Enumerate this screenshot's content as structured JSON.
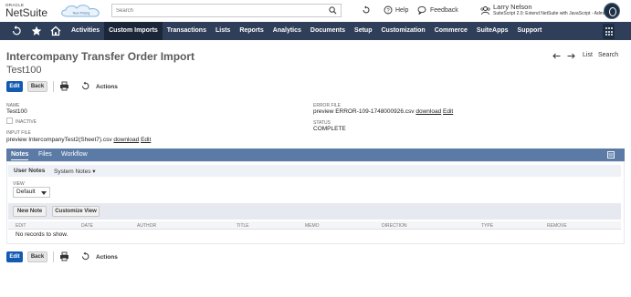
{
  "header": {
    "brand_top": "ORACLE",
    "brand": "NetSuite",
    "cloud_text": "New Pricing",
    "search_placeholder": "Search",
    "help": "Help",
    "feedback": "Feedback",
    "user_name": "Larry Nelson",
    "user_role": "SuiteScript 2.0: Extend NetSuite with JavaScript - Administrator"
  },
  "nav": {
    "items": [
      "Activities",
      "Custom Imports",
      "Transactions",
      "Lists",
      "Reports",
      "Analytics",
      "Documents",
      "Setup",
      "Customization",
      "Commerce",
      "SuiteApps",
      "Support"
    ],
    "active": "Custom Imports"
  },
  "page": {
    "title": "Intercompany Transfer Order Import",
    "record_name": "Test100",
    "record_nav": {
      "list": "List",
      "search": "Search"
    }
  },
  "buttons": {
    "edit": "Edit",
    "back": "Back",
    "actions": "Actions"
  },
  "fields": {
    "name_label": "NAME",
    "name_value": "Test100",
    "inactive_label": "INACTIVE",
    "input_file_label": "INPUT FILE",
    "input_file_value": "preview IntercompanyTest2(Sheet7).csv",
    "error_file_label": "ERROR FILE",
    "error_file_value": "preview ERROR-109-1748000926.csv",
    "status_label": "STATUS",
    "status_value": "COMPLETE",
    "download": "download",
    "edit_link": "Edit"
  },
  "subtabs": [
    "Notes",
    "Files",
    "Workflow"
  ],
  "notes": {
    "inner_tabs": {
      "user_notes": "User Notes",
      "system_notes": "System Notes ▾"
    },
    "view_label": "VIEW",
    "view_value": "Default",
    "new_note": "New Note",
    "customize_view": "Customize View",
    "columns": [
      "EDIT",
      "DATE",
      "AUTHOR",
      "TITLE",
      "MEMO",
      "DIRECTION",
      "TYPE",
      "REMOVE"
    ],
    "empty": "No records to show."
  },
  "colors": {
    "nav_bg": "#2f3f5a",
    "nav_active": "#1b2638",
    "primary": "#125ab2",
    "subtab_bar": "#5b7ba6"
  }
}
